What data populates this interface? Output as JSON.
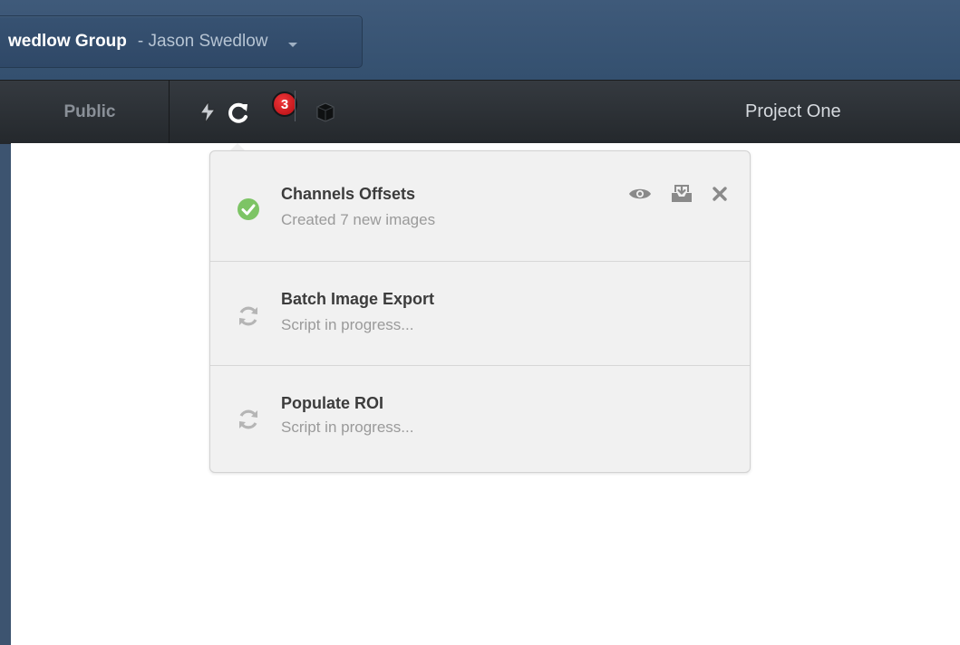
{
  "header": {
    "group_name": "wedlow Group",
    "group_user": "- Jason Swedlow"
  },
  "nav": {
    "public_label": "Public",
    "activity_badge": "3",
    "project_title": "Project One"
  },
  "activities": [
    {
      "title": "Channels Offsets",
      "subtitle": "Created 7 new images",
      "status": "complete"
    },
    {
      "title": "Batch Image Export",
      "subtitle": "Script in progress...",
      "status": "in-progress"
    },
    {
      "title": "Populate ROI",
      "subtitle": "Script in progress...",
      "status": "in-progress"
    }
  ],
  "colors": {
    "success": "#7dc465",
    "badge": "#d61a1e",
    "header_bg": "#3a5474",
    "nav_bg": "#2c3035"
  }
}
